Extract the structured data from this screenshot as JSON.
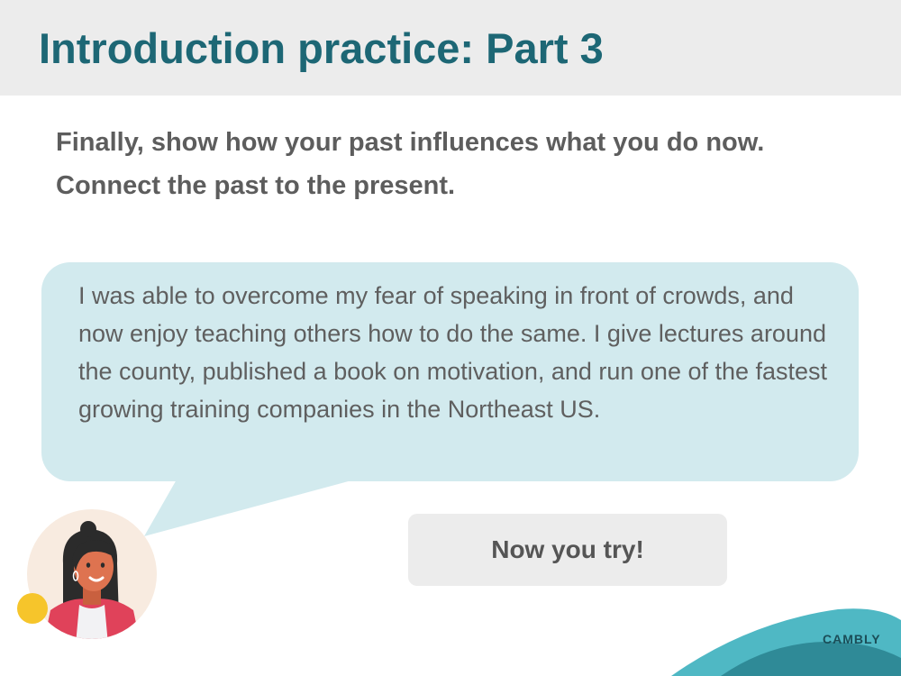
{
  "header": {
    "title": "Introduction practice: Part 3"
  },
  "instruction": {
    "text": "Finally, show how your past influences what you do now. Connect the past to the present."
  },
  "speech_bubble": {
    "text": "I was able to overcome my fear of speaking in front of crowds, and now enjoy teaching others how to do the same. I give lectures around the county, published a book on motivation, and run one of the fastest growing training companies in the Northeast US."
  },
  "action": {
    "try_label": "Now you try!"
  },
  "brand": {
    "logo_text": "CAMBLY"
  },
  "colors": {
    "title": "#1d6775",
    "bubble": "#d2eaee",
    "header_bg": "#ececec",
    "brand_teal": "#4fb8c4",
    "brand_dark": "#1b4d57"
  }
}
